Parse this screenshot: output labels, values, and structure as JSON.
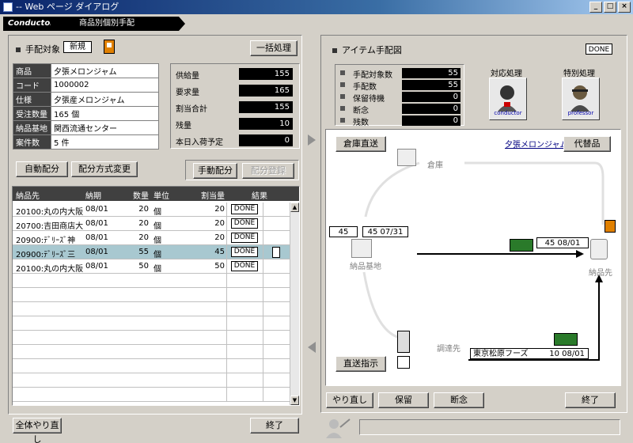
{
  "window": {
    "title": "-- Web ページ ダイアログ"
  },
  "breadcrumb": {
    "app": "Conductor",
    "page": "商品別個別手配"
  },
  "left": {
    "section_title": "手配対象",
    "mode_badge": "新規",
    "bulk_button": "一括処理",
    "info": [
      {
        "k": "商品",
        "v": "夕張メロンジャム"
      },
      {
        "k": "コード",
        "v": "1000002"
      },
      {
        "k": "仕様",
        "v": "夕張産メロンジャム"
      },
      {
        "k": "受注数量",
        "v": "165 個"
      },
      {
        "k": "納品基地",
        "v": "関西流通センター"
      },
      {
        "k": "案件数",
        "v": "5 件"
      }
    ],
    "stats": [
      {
        "k": "供給量",
        "v": "155"
      },
      {
        "k": "要求量",
        "v": "165"
      },
      {
        "k": "割当合計",
        "v": "155"
      },
      {
        "k": "残量",
        "v": "10"
      },
      {
        "k": "本日入荷予定",
        "v": "0"
      }
    ],
    "buttons": {
      "auto": "自動配分",
      "change": "配分方式変更",
      "manual": "手動配分",
      "register": "配分登録",
      "reset_all": "全体やり直し",
      "end": "終了"
    },
    "grid": {
      "headers": [
        "納品先",
        "納期",
        "数量",
        "単位",
        "割当量",
        "結果"
      ],
      "rows": [
        {
          "dest": "20100:丸の内大阪",
          "due": "08/01",
          "qty": "20",
          "unit": "個",
          "alloc": "20",
          "result": "DONE",
          "sel": false
        },
        {
          "dest": "20700:吉田商店大",
          "due": "08/01",
          "qty": "20",
          "unit": "個",
          "alloc": "20",
          "result": "DONE",
          "sel": false
        },
        {
          "dest": "20900:ﾃﾞﾘｰｽﾞ神",
          "due": "08/01",
          "qty": "20",
          "unit": "個",
          "alloc": "20",
          "result": "DONE",
          "sel": false
        },
        {
          "dest": "20900:ﾃﾞﾘｰｽﾞ三",
          "due": "08/01",
          "qty": "55",
          "unit": "個",
          "alloc": "45",
          "result": "DONE",
          "sel": true
        },
        {
          "dest": "20100:丸の内大阪",
          "due": "08/01",
          "qty": "50",
          "unit": "個",
          "alloc": "50",
          "result": "DONE",
          "sel": false
        }
      ]
    }
  },
  "right": {
    "section_title": "アイテム手配図",
    "status": "DONE",
    "counts": [
      {
        "k": "手配対象数",
        "v": "55"
      },
      {
        "k": "手配数",
        "v": "55"
      },
      {
        "k": "保留待機",
        "v": "0"
      },
      {
        "k": "断念",
        "v": "0"
      },
      {
        "k": "残数",
        "v": "0"
      }
    ],
    "handlers": {
      "conductor_label": "対応処理",
      "conductor_caption": "conductor",
      "professor_label": "特別処理",
      "professor_caption": "professor"
    },
    "diagram": {
      "warehouse_button": "倉庫直送",
      "item_link": "夕張メロンジャム",
      "substitute_button": "代替品",
      "warehouse_label": "倉庫",
      "base_label": "納品基地",
      "dest_label": "納品先",
      "supplier_label": "調達先",
      "base_qty": "45",
      "base_qty_date": "45 07/31",
      "truck_qty_date": "45 08/01",
      "direct_button": "直送指示",
      "supplier_name": "東京松原フーズ",
      "supplier_qty_date": "10 08/01"
    },
    "buttons": {
      "redo": "やり直し",
      "hold": "保留",
      "abandon": "断念",
      "end": "終了"
    }
  }
}
